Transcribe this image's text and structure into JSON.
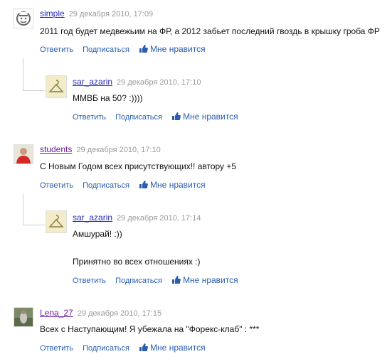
{
  "actions": {
    "reply": "Ответить",
    "subscribe": "Подписаться",
    "like": "Мне нравится"
  },
  "comments": [
    {
      "author": "simple",
      "date": "29 декабря 2010, 17:09",
      "text": "2011 год будет медвежьим на ФР, а 2012 забьет последний гвоздь в крышку гроба ФР",
      "avatar_icon": "smiley-avatar-icon"
    },
    {
      "author": "sar_azarin",
      "date": "29 декабря 2010, 17:10",
      "text": "ММВБ на 50? :))))",
      "avatar_icon": "hanger-avatar-icon"
    },
    {
      "author": "students",
      "date": "29 декабря 2010, 17:10",
      "text": "С Новым Годом всех присутствующих!! автору +5",
      "avatar_icon": "person-photo-avatar"
    },
    {
      "author": "sar_azarin",
      "date": "29 декабря 2010, 17:14",
      "text_line1": "Амшурай! :))",
      "text_line2": "Принятно во всех отношениях :)",
      "avatar_icon": "hanger-avatar-icon"
    },
    {
      "author": "Lena_27",
      "date": "29 декабря 2010, 17:15",
      "text": "Всех с Наступающим! Я убежала на \"Форекс-клаб\" : ***",
      "avatar_icon": "photo-avatar"
    }
  ]
}
